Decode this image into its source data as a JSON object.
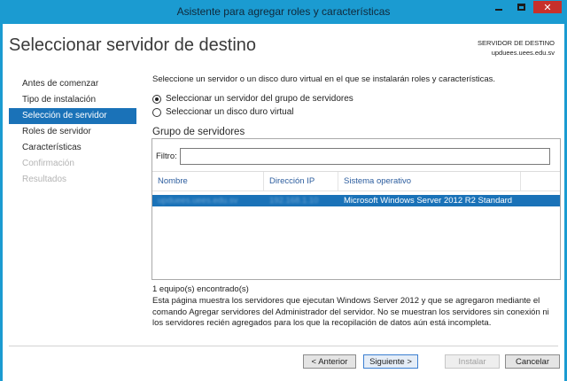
{
  "window": {
    "title": "Asistente para agregar roles y características",
    "minimize_label": "minimize",
    "maximize_label": "maximize",
    "close_label": "✕"
  },
  "header": {
    "page_title": "Seleccionar servidor de destino",
    "dest_label": "SERVIDOR DE DESTINO",
    "dest_server": "upduees.uees.edu.sv"
  },
  "nav": {
    "items": [
      {
        "label": "Antes de comenzar",
        "state": "normal"
      },
      {
        "label": "Tipo de instalación",
        "state": "normal"
      },
      {
        "label": "Selección de servidor",
        "state": "active"
      },
      {
        "label": "Roles de servidor",
        "state": "normal"
      },
      {
        "label": "Características",
        "state": "normal"
      },
      {
        "label": "Confirmación",
        "state": "disabled"
      },
      {
        "label": "Resultados",
        "state": "disabled"
      }
    ]
  },
  "main": {
    "intro": "Seleccione un servidor o un disco duro virtual en el que se instalarán roles y características.",
    "radio_pool": "Seleccionar un servidor del grupo de servidores",
    "radio_vhd": "Seleccionar un disco duro virtual",
    "selected_option": "pool",
    "group_label": "Grupo de servidores",
    "filter_label": "Filtro:",
    "filter_value": "",
    "columns": [
      "Nombre",
      "Dirección IP",
      "Sistema operativo"
    ],
    "rows": [
      {
        "name": "upduees.uees.edu.sv",
        "ip": "192.168.1.10",
        "os": "Microsoft Windows Server 2012 R2 Standard",
        "selected": true
      }
    ],
    "count_text": "1 equipo(s) encontrado(s)",
    "info_text": "Esta página muestra los servidores que ejecutan Windows Server 2012 y que se agregaron mediante el comando Agregar servidores del Administrador del servidor. No se muestran los servidores sin conexión ni los servidores recién agregados para los que la recopilación de datos aún está incompleta."
  },
  "footer": {
    "prev": "< Anterior",
    "next": "Siguiente >",
    "install": "Instalar",
    "cancel": "Cancelar"
  },
  "colors": {
    "titlebar": "#1b9bd1",
    "selection": "#1a72b8",
    "close": "#c7302b"
  }
}
